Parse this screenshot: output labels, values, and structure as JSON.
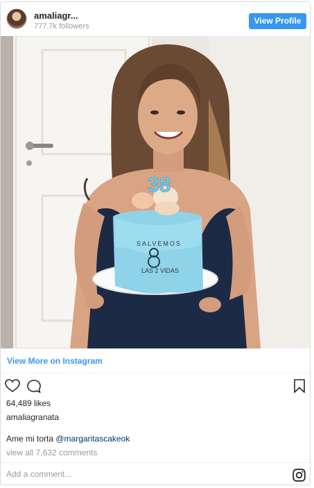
{
  "header": {
    "username": "amaliagr...",
    "followers": "777.7k followers",
    "view_profile_label": "View Profile"
  },
  "photo": {
    "cake_top_text": "SALVEMOS",
    "cake_bottom_text": "LAS 2 VIDAS",
    "candles": "38"
  },
  "view_more_label": "View More on Instagram",
  "actions": {
    "icons": [
      "heart-icon",
      "comment-icon",
      "bookmark-icon"
    ]
  },
  "likes": "64,489 likes",
  "owner": "amaliagranata",
  "caption": {
    "text": "Ame mi torta ",
    "mention": "@margaritascakeok"
  },
  "comments_link": "view all 7,632 comments",
  "comment_placeholder": "Add a comment...",
  "colors": {
    "accent": "#3897f0",
    "mention": "#003569",
    "muted": "#999999",
    "cake": "#8fd3e8"
  }
}
